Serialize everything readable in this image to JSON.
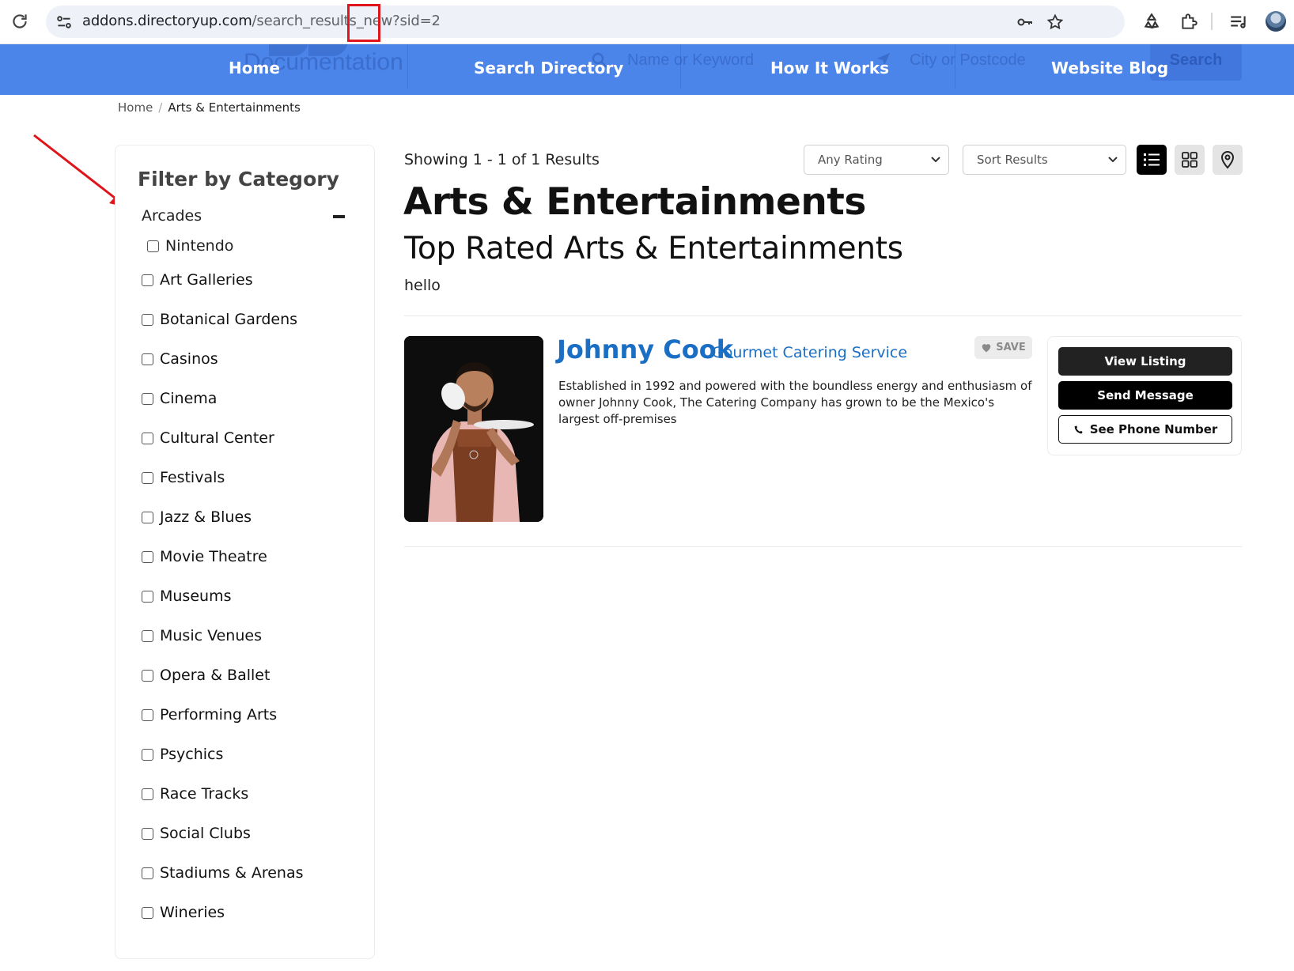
{
  "browser": {
    "url_host": "addons.directoryup.com",
    "url_path": "/search_results_new?sid=2"
  },
  "nav": {
    "ghost_logo": "Documentation",
    "ghost_keyword_placeholder": "Name or Keyword",
    "ghost_location_placeholder": "City or Postcode",
    "ghost_search_button": "Search",
    "links": [
      "Home",
      "Search Directory",
      "How It Works",
      "Website Blog"
    ]
  },
  "breadcrumb": {
    "home": "Home",
    "separator": "/",
    "current": "Arts & Entertainments"
  },
  "sidebar": {
    "title": "Filter by Category",
    "expanded_group": "Arcades",
    "collapse_symbol": "−",
    "subcategories": [
      "Nintendo"
    ],
    "categories": [
      "Art Galleries",
      "Botanical Gardens",
      "Casinos",
      "Cinema",
      "Cultural Center",
      "Festivals",
      "Jazz & Blues",
      "Movie Theatre",
      "Museums",
      "Music Venues",
      "Opera & Ballet",
      "Performing Arts",
      "Psychics",
      "Race Tracks",
      "Social Clubs",
      "Stadiums & Arenas",
      "Wineries"
    ]
  },
  "results": {
    "showing": "Showing 1 - 1 of 1 Results",
    "rating_select": "Any Rating",
    "sort_select": "Sort Results",
    "active_view": "list"
  },
  "page": {
    "title": "Arts & Entertainments",
    "subtitle": "Top Rated Arts & Entertainments",
    "description": "hello"
  },
  "listing": {
    "name": "Johnny Cook",
    "subtitle": "Gourmet Catering Service",
    "save_label": "SAVE",
    "text": "Established in 1992 and powered with the boundless energy and enthusiasm of owner Johnny Cook, The Catering Company has grown to be the Mexico's largest off-premises",
    "buttons": {
      "view": "View Listing",
      "message": "Send Message",
      "phone": "See Phone Number"
    }
  },
  "colors": {
    "nav_bg": "#4b85ea",
    "link_blue": "#1a6fc4",
    "annotation_red": "#e0151b"
  }
}
